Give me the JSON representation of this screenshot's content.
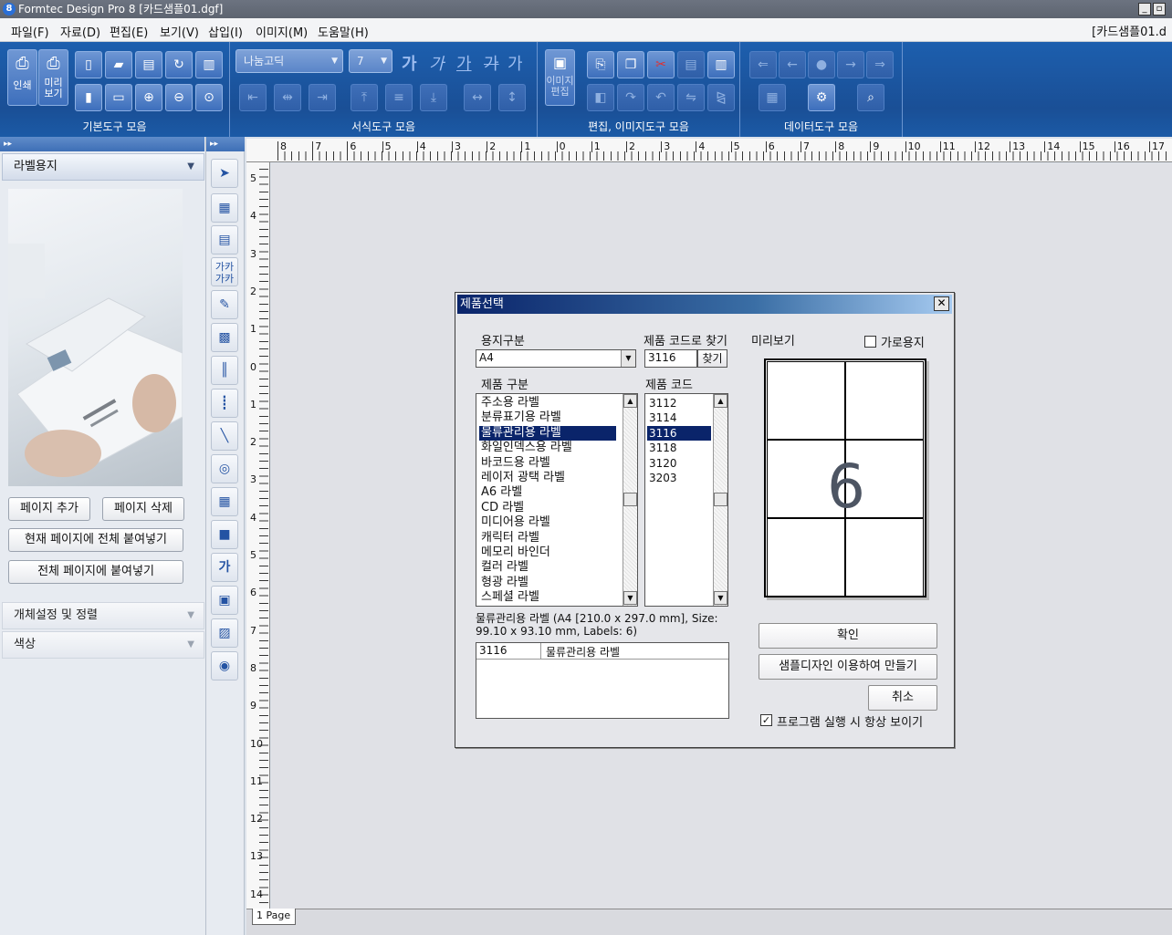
{
  "window": {
    "title": "Formtec Design Pro 8 [카드샘플01.dgf]",
    "logo": "8",
    "min": "_",
    "restore": "▫",
    "doc_right": "[카드샘플01.d"
  },
  "menu": [
    "파일(F)",
    "자료(D)",
    "편집(E)",
    "보기(V)",
    "삽입(I)",
    "이미지(M)",
    "도움말(H)"
  ],
  "toolbar": {
    "groups": [
      "기본도구 모음",
      "서식도구 모음",
      "편집, 이미지도구 모음",
      "데이터도구 모음"
    ],
    "print_label": "인쇄",
    "preview_label": "미리\n보기",
    "image_edit_label": "이미지\n편집",
    "font": "나눔고딕",
    "font_size": "7",
    "text_styles": [
      "가",
      "가",
      "가",
      "가",
      "가"
    ]
  },
  "left": {
    "section_title": "라벨용지",
    "btn_add": "페이지 추가",
    "btn_delete": "페이지 삭제",
    "btn_paste_current": "현재 페이지에 전체 붙여넣기",
    "btn_paste_all": "전체 페이지에 붙여넣기",
    "section2": "개체설정 및 정렬",
    "section3": "색상"
  },
  "ruler": {
    "top": [
      "8",
      "7",
      "6",
      "5",
      "4",
      "3",
      "2",
      "1",
      "0",
      "1",
      "2",
      "3",
      "4",
      "5",
      "6",
      "7",
      "8",
      "9",
      "10",
      "11",
      "12",
      "13",
      "14",
      "15",
      "16",
      "17"
    ],
    "left": [
      "5",
      "4",
      "3",
      "2",
      "1",
      "0",
      "1",
      "2",
      "3",
      "4",
      "5",
      "6",
      "7",
      "8",
      "9",
      "10",
      "11",
      "12",
      "13",
      "14"
    ]
  },
  "page_tab": "1 Page",
  "dialog": {
    "title": "제품선택",
    "close": "✕",
    "paper_type_label": "용지구분",
    "paper_type_value": "A4",
    "find_code_label": "제품 코드로 찾기",
    "find_code_value": "3116",
    "find_button": "찾기",
    "preview_label": "미리보기",
    "landscape_label": "가로용지",
    "landscape_checked": false,
    "category_label": "제품 구분",
    "categories": [
      "주소용 라벨",
      "분류표기용 라벨",
      "물류관리용 라벨",
      "화일인덱스용 라벨",
      "바코드용 라벨",
      "레이저 광택 라벨",
      "A6 라벨",
      "CD 라벨",
      "미디어용 라벨",
      "캐릭터 라벨",
      "메모리 바인더",
      "컬러 라벨",
      "형광 라벨",
      "스페셜 라벨"
    ],
    "selected_category": 2,
    "code_label": "제품 코드",
    "codes": [
      "3112",
      "3114",
      "3116",
      "3118",
      "3120",
      "3203"
    ],
    "selected_code": 2,
    "description": "물류관리용 라벨 (A4 [210.0 x 297.0 mm], Size: 99.10 x 93.10 mm, Labels: 6)",
    "description_line1": "물류관리용 라벨 (A4 [210.0 x 297.0 mm], Size:",
    "description_line2": "99.10 x 93.10 mm, Labels: 6)",
    "table_row": {
      "code": "3116",
      "name": "물류관리용 라벨"
    },
    "preview_count": "6",
    "btn_ok": "확인",
    "btn_sample": "샘플디자인 이용하여 만들기",
    "btn_cancel": "취소",
    "always_show_label": "프로그램 실행 시 항상 보이기",
    "always_show_checked": true
  }
}
